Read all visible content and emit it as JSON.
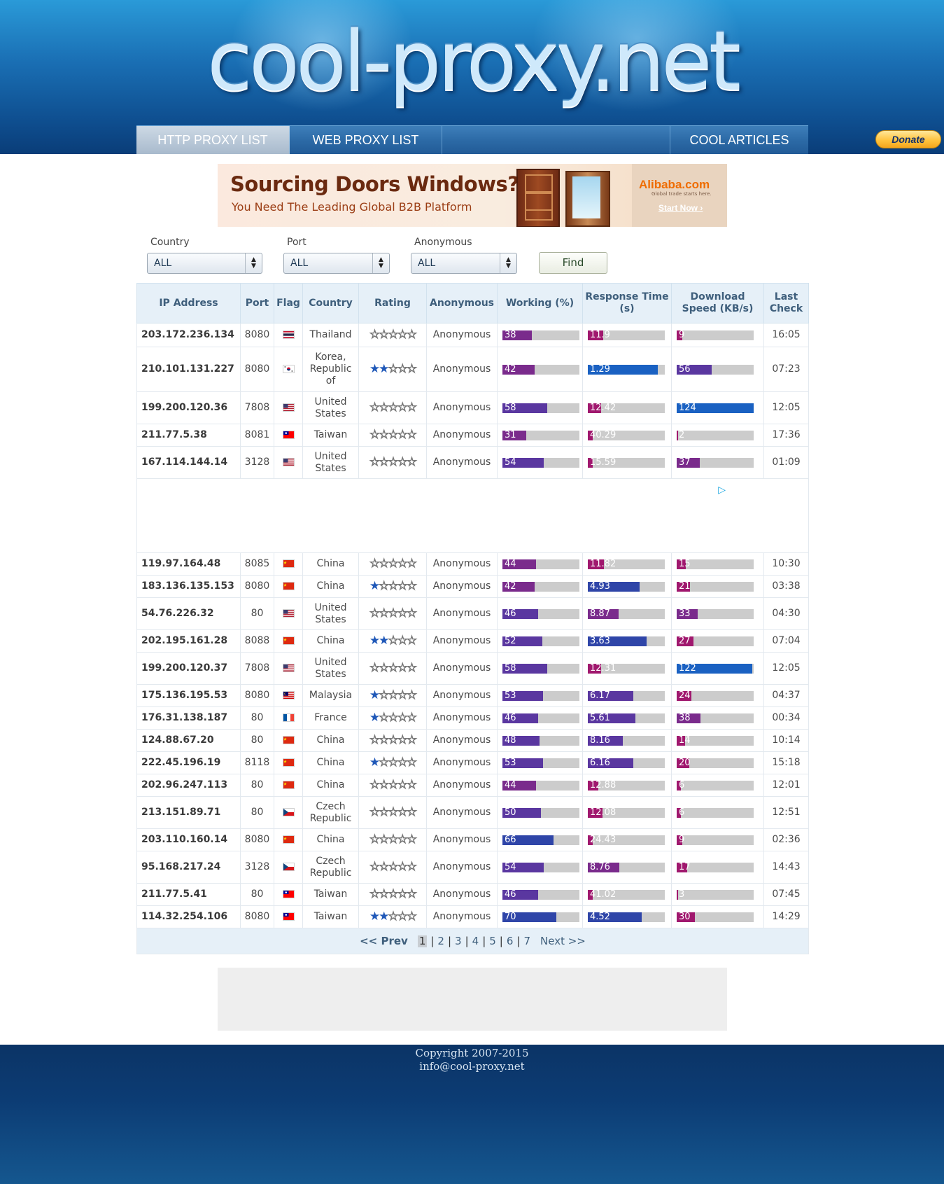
{
  "site": {
    "logo_text": "cool-proxy.net"
  },
  "menu": {
    "items": [
      {
        "label": "HTTP PROXY LIST"
      },
      {
        "label": "WEB PROXY LIST"
      },
      {
        "label": "COOL ARTICLES"
      }
    ],
    "donate_label": "Donate"
  },
  "ad_top": {
    "headline": "Sourcing Doors  Windows?",
    "subline": "You Need The Leading Global B2B Platform",
    "brand": "Alibaba.com",
    "tagline": "Global trade starts here.",
    "cta": "Start Now"
  },
  "filters": {
    "country": {
      "label": "Country",
      "value": "ALL"
    },
    "port": {
      "label": "Port",
      "value": "ALL"
    },
    "anonymous": {
      "label": "Anonymous",
      "value": "ALL"
    },
    "find_label": "Find"
  },
  "table": {
    "headers": [
      "IP Address",
      "Port",
      "Flag",
      "Country",
      "Rating",
      "Anonymous",
      "Working (%)",
      "Response Time (s)",
      "Download Speed (KB/s)",
      "Last Check"
    ],
    "ad_row_after": 5,
    "rows": [
      {
        "ip": "203.172.236.134",
        "port": "8080",
        "flag": "TH",
        "country": "Thailand",
        "rating": 0,
        "anon": "Anonymous",
        "working": "38",
        "response": "11.9",
        "download": "9",
        "last": "16:05"
      },
      {
        "ip": "210.101.131.227",
        "port": "8080",
        "flag": "KR",
        "country": "Korea, Republic of",
        "rating": 2,
        "anon": "Anonymous",
        "working": "42",
        "response": "1.29",
        "download": "56",
        "last": "07:23"
      },
      {
        "ip": "199.200.120.36",
        "port": "7808",
        "flag": "US",
        "country": "United States",
        "rating": 0,
        "anon": "Anonymous",
        "working": "58",
        "response": "12.42",
        "download": "124",
        "last": "12:05"
      },
      {
        "ip": "211.77.5.38",
        "port": "8081",
        "flag": "TW",
        "country": "Taiwan",
        "rating": 0,
        "anon": "Anonymous",
        "working": "31",
        "response": "40.29",
        "download": "2",
        "last": "17:36"
      },
      {
        "ip": "167.114.144.14",
        "port": "3128",
        "flag": "US",
        "country": "United States",
        "rating": 0,
        "anon": "Anonymous",
        "working": "54",
        "response": "15.59",
        "download": "37",
        "last": "01:09"
      },
      {
        "ip": "119.97.164.48",
        "port": "8085",
        "flag": "CN",
        "country": "China",
        "rating": 0,
        "anon": "Anonymous",
        "working": "44",
        "response": "11.82",
        "download": "15",
        "last": "10:30"
      },
      {
        "ip": "183.136.135.153",
        "port": "8080",
        "flag": "CN",
        "country": "China",
        "rating": 1,
        "anon": "Anonymous",
        "working": "42",
        "response": "4.93",
        "download": "21",
        "last": "03:38"
      },
      {
        "ip": "54.76.226.32",
        "port": "80",
        "flag": "US",
        "country": "United States",
        "rating": 0,
        "anon": "Anonymous",
        "working": "46",
        "response": "8.87",
        "download": "33",
        "last": "04:30"
      },
      {
        "ip": "202.195.161.28",
        "port": "8088",
        "flag": "CN",
        "country": "China",
        "rating": 2,
        "anon": "Anonymous",
        "working": "52",
        "response": "3.63",
        "download": "27",
        "last": "07:04"
      },
      {
        "ip": "199.200.120.37",
        "port": "7808",
        "flag": "US",
        "country": "United States",
        "rating": 0,
        "anon": "Anonymous",
        "working": "58",
        "response": "12.31",
        "download": "122",
        "last": "12:05"
      },
      {
        "ip": "175.136.195.53",
        "port": "8080",
        "flag": "MY",
        "country": "Malaysia",
        "rating": 1,
        "anon": "Anonymous",
        "working": "53",
        "response": "6.17",
        "download": "24",
        "last": "04:37"
      },
      {
        "ip": "176.31.138.187",
        "port": "80",
        "flag": "FR",
        "country": "France",
        "rating": 1,
        "anon": "Anonymous",
        "working": "46",
        "response": "5.61",
        "download": "38",
        "last": "00:34"
      },
      {
        "ip": "124.88.67.20",
        "port": "80",
        "flag": "CN",
        "country": "China",
        "rating": 0,
        "anon": "Anonymous",
        "working": "48",
        "response": "8.16",
        "download": "14",
        "last": "10:14"
      },
      {
        "ip": "222.45.196.19",
        "port": "8118",
        "flag": "CN",
        "country": "China",
        "rating": 1,
        "anon": "Anonymous",
        "working": "53",
        "response": "6.16",
        "download": "20",
        "last": "15:18"
      },
      {
        "ip": "202.96.247.113",
        "port": "80",
        "flag": "CN",
        "country": "China",
        "rating": 0,
        "anon": "Anonymous",
        "working": "44",
        "response": "12.88",
        "download": "6",
        "last": "12:01"
      },
      {
        "ip": "213.151.89.71",
        "port": "80",
        "flag": "CZ",
        "country": "Czech Republic",
        "rating": 0,
        "anon": "Anonymous",
        "working": "50",
        "response": "12.08",
        "download": "6",
        "last": "12:51"
      },
      {
        "ip": "203.110.160.14",
        "port": "8080",
        "flag": "CN",
        "country": "China",
        "rating": 0,
        "anon": "Anonymous",
        "working": "66",
        "response": "24.43",
        "download": "9",
        "last": "02:36"
      },
      {
        "ip": "95.168.217.24",
        "port": "3128",
        "flag": "CZ",
        "country": "Czech Republic",
        "rating": 0,
        "anon": "Anonymous",
        "working": "54",
        "response": "8.76",
        "download": "17",
        "last": "14:43"
      },
      {
        "ip": "211.77.5.41",
        "port": "80",
        "flag": "TW",
        "country": "Taiwan",
        "rating": 0,
        "anon": "Anonymous",
        "working": "46",
        "response": "41.02",
        "download": "3",
        "last": "07:45"
      },
      {
        "ip": "114.32.254.106",
        "port": "8080",
        "flag": "TW",
        "country": "Taiwan",
        "rating": 2,
        "anon": "Anonymous",
        "working": "70",
        "response": "4.52",
        "download": "30",
        "last": "14:29"
      }
    ]
  },
  "pagination": {
    "prev": "<< Prev",
    "next": "Next >>",
    "pages": [
      "1",
      "2",
      "3",
      "4",
      "5",
      "6",
      "7"
    ],
    "current": "1"
  },
  "footer": {
    "copyright": "Copyright 2007-2015",
    "email": "info@cool-proxy.net"
  },
  "colors": {
    "header_blue": "#1a6fb4",
    "table_header_bg": "#e6f0f8",
    "star_on": "#1f58b8",
    "bar_bg": "#cccccc"
  }
}
